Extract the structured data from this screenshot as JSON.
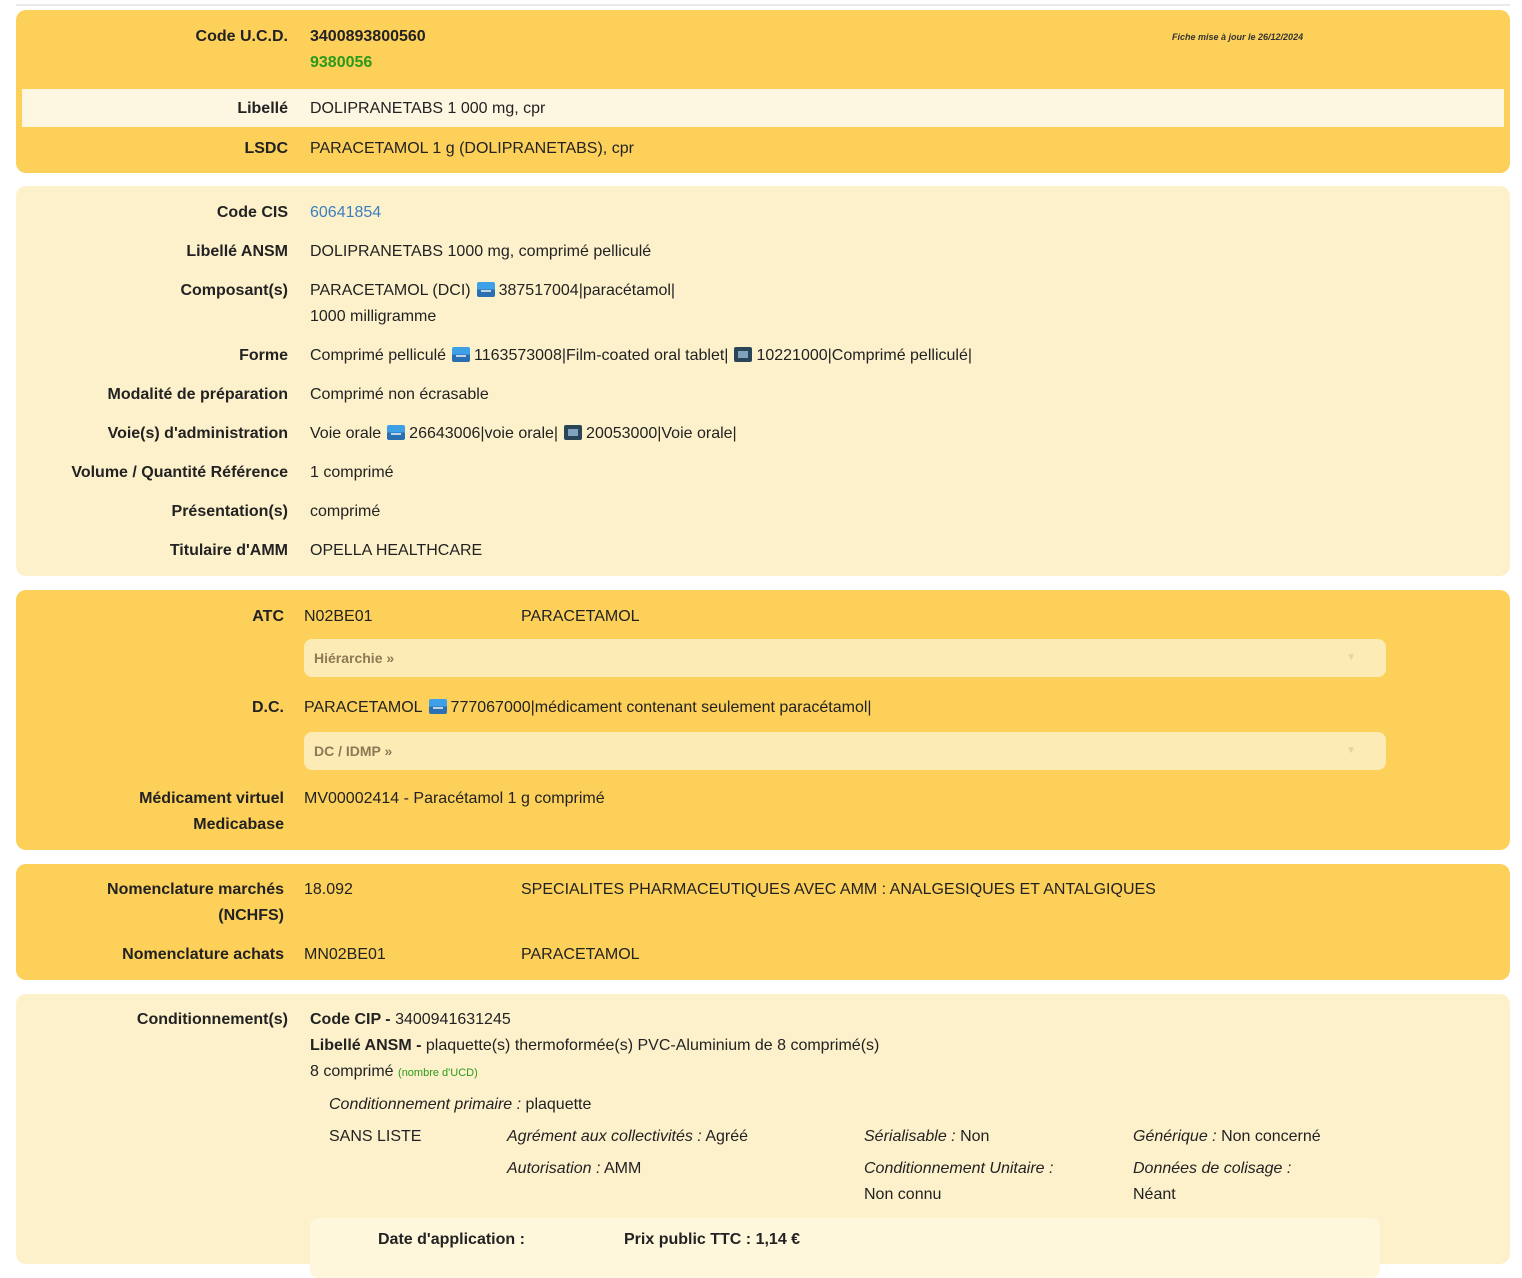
{
  "ucd_panel": {
    "code_ucd_label": "Code U.C.D.",
    "code_ucd": "3400893800560",
    "code_ucd_short": "9380056",
    "update_note": "Fiche mise à jour le 26/12/2024",
    "libelle_label": "Libellé",
    "libelle": "DOLIPRANETABS 1 000 mg, cpr",
    "lsdc_label": "LSDC",
    "lsdc": "PARACETAMOL 1 g (DOLIPRANETABS), cpr"
  },
  "cis_panel": {
    "code_cis_label": "Code CIS",
    "code_cis": "60641854",
    "libelle_ansm_label": "Libellé ANSM",
    "libelle_ansm": "DOLIPRANETABS 1000 mg, comprimé pelliculé",
    "composants_label": "Composant(s)",
    "composant_name": "PARACETAMOL (DCI)",
    "composant_code": "387517004|paracétamol|",
    "composant_dose": "1000 milligramme",
    "forme_label": "Forme",
    "forme": "Comprimé pelliculé",
    "forme_code1": "1163573008|Film-coated oral tablet|",
    "forme_code2": "10221000|Comprimé pelliculé|",
    "modalite_label": "Modalité de préparation",
    "modalite": "Comprimé non écrasable",
    "voies_label": "Voie(s) d'administration",
    "voie": "Voie orale",
    "voie_code1": "26643006|voie orale|",
    "voie_code2": "20053000|Voie orale|",
    "volume_label": "Volume / Quantité Référence",
    "volume": "1 comprimé",
    "presentations_label": "Présentation(s)",
    "presentation": "comprimé",
    "titulaire_label": "Titulaire d'AMM",
    "titulaire": "OPELLA HEALTHCARE"
  },
  "atc_panel": {
    "atc_label": "ATC",
    "atc_code": "N02BE01",
    "atc_name": "PARACETAMOL",
    "hierarchy_label": "Hiérarchie »",
    "dc_label": "D.C.",
    "dc_name": "PARACETAMOL",
    "dc_code": "777067000|médicament contenant seulement paracétamol|",
    "dc_idmp_label": "DC / IDMP »",
    "mv_label_line1": "Médicament virtuel",
    "mv_label_line2": "Medicabase",
    "mv_value": "MV00002414 - Paracétamol 1 g comprimé"
  },
  "nomenclature_panel": {
    "marches_label_line1": "Nomenclature marchés",
    "marches_label_line2": "(NCHFS)",
    "marches_code": "18.092",
    "marches_name": "SPECIALITES PHARMACEUTIQUES AVEC AMM : ANALGESIQUES ET ANTALGIQUES",
    "achats_label": "Nomenclature achats",
    "achats_code": "MN02BE01",
    "achats_name": "PARACETAMOL"
  },
  "conditionnement_panel": {
    "label": "Conditionnement(s)",
    "cip_label": "Code CIP -",
    "cip_value": "3400941631245",
    "libelle_ansm_label": "Libellé ANSM -",
    "libelle_ansm_value": "plaquette(s) thermoformée(s) PVC-Aluminium de 8 comprimé(s)",
    "count": "8 comprimé",
    "count_note": "(nombre d'UCD)",
    "primaire_label": "Conditionnement primaire :",
    "primaire_value": "plaquette",
    "liste": "SANS LISTE",
    "agrement_label": "Agrément aux collectivités :",
    "agrement_value": "Agréé",
    "serialisable_label": "Sérialisable :",
    "serialisable_value": "Non",
    "generique_label": "Générique :",
    "generique_value": "Non concerné",
    "autorisation_label": "Autorisation :",
    "autorisation_value": "AMM",
    "cond_unitaire_label": "Conditionnement Unitaire :",
    "cond_unitaire_value": "Non connu",
    "colisage_label": "Données de colisage :",
    "colisage_value": "Néant",
    "date_application_label": "Date d'application :",
    "prix_label": "Prix public TTC :",
    "prix_value": "1,14 €"
  },
  "icons": {
    "snomed": "snomed-icon",
    "edqm": "edqm-icon"
  },
  "colors": {
    "panel_dark": "#fdd05a",
    "panel_light": "#fdf1cc",
    "green_code": "#2a9a1a",
    "link": "#3a7fc0"
  }
}
